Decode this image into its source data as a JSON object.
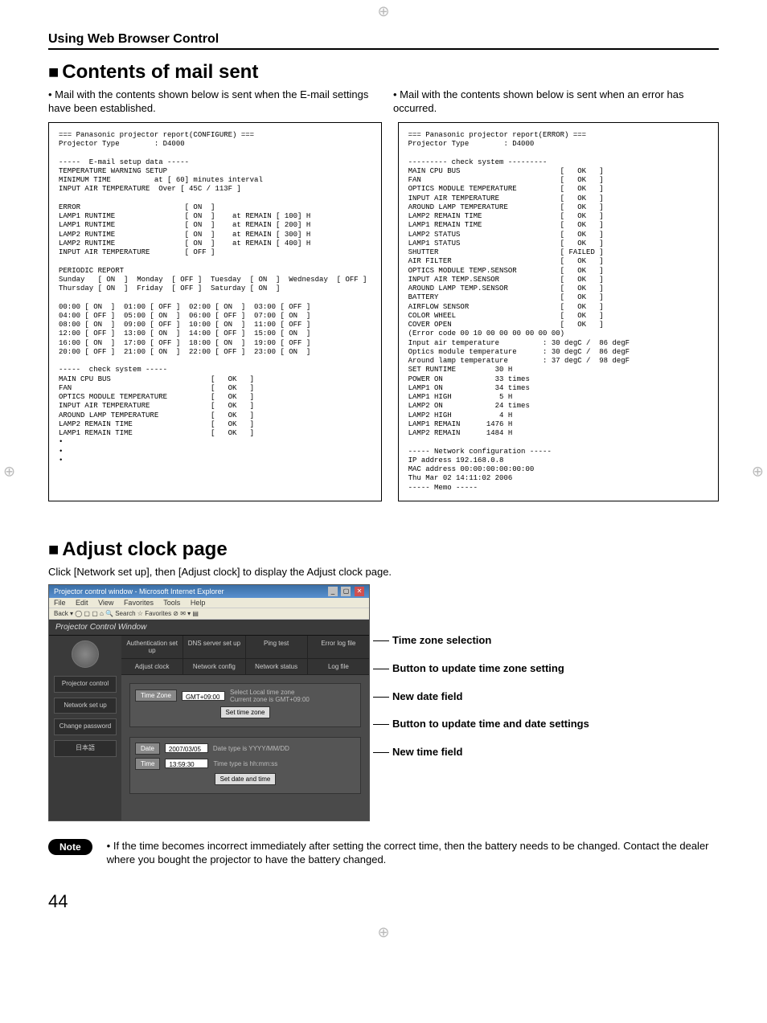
{
  "page": {
    "section_header": "Using Web Browser Control",
    "title1": "Contents of mail sent",
    "title1_marker": "■",
    "intro_left": "• Mail with the contents shown below is sent when the E-mail settings have been established.",
    "intro_right": "• Mail with the contents shown below is sent when an error has occurred.",
    "title2": "Adjust clock page",
    "title2_marker": "■",
    "clock_intro": "Click [Network set up], then [Adjust clock] to display the Adjust clock page.",
    "note_label": "Note",
    "note_text": "• If the time becomes incorrect immediately after setting the correct time, then the battery needs to be changed. Contact the dealer where you bought the projector to have the battery changed.",
    "page_number": "44"
  },
  "mail_left": "=== Panasonic projector report(CONFIGURE) ===\nProjector Type        : D4000\n\n-----  E-mail setup data -----\nTEMPERATURE WARNING SETUP\nMINIMUM TIME          at [ 60] minutes interval\nINPUT AIR TEMPERATURE  Over [ 45C / 113F ]\n\nERROR                        [ ON  ]\nLAMP1 RUNTIME                [ ON  ]    at REMAIN [ 100] H\nLAMP1 RUNTIME                [ ON  ]    at REMAIN [ 200] H\nLAMP2 RUNTIME                [ ON  ]    at REMAIN [ 300] H\nLAMP2 RUNTIME                [ ON  ]    at REMAIN [ 400] H\nINPUT AIR TEMPERATURE        [ OFF ]\n\nPERIODIC REPORT\nSunday   [ ON  ]  Monday  [ OFF ]  Tuesday  [ ON  ]  Wednesday  [ OFF ]\nThursday [ ON  ]  Friday  [ OFF ]  Saturday [ ON  ]\n\n00:00 [ ON  ]  01:00 [ OFF ]  02:00 [ ON  ]  03:00 [ OFF ]\n04:00 [ OFF ]  05:00 [ ON  ]  06:00 [ OFF ]  07:00 [ ON  ]\n08:00 [ ON  ]  09:00 [ OFF ]  10:00 [ ON  ]  11:00 [ OFF ]\n12:00 [ OFF ]  13:00 [ ON  ]  14:00 [ OFF ]  15:00 [ ON  ]\n16:00 [ ON  ]  17:00 [ OFF ]  18:00 [ ON  ]  19:00 [ OFF ]\n20:00 [ OFF ]  21:00 [ ON  ]  22:00 [ OFF ]  23:00 [ ON  ]\n\n-----  check system -----\nMAIN CPU BUS                       [   OK   ]\nFAN                                [   OK   ]\nOPTICS MODULE TEMPERATURE          [   OK   ]\nINPUT AIR TEMPERATURE              [   OK   ]\nAROUND LAMP TEMPERATURE            [   OK   ]\nLAMP2 REMAIN TIME                  [   OK   ]\nLAMP1 REMAIN TIME                  [   OK   ]\n•\n•\n•",
  "mail_right": "=== Panasonic projector report(ERROR) ===\nProjector Type        : D4000\n\n--------- check system ---------\nMAIN CPU BUS                       [   OK   ]\nFAN                                [   OK   ]\nOPTICS MODULE TEMPERATURE          [   OK   ]\nINPUT AIR TEMPERATURE              [   OK   ]\nAROUND LAMP TEMPERATURE            [   OK   ]\nLAMP2 REMAIN TIME                  [   OK   ]\nLAMP1 REMAIN TIME                  [   OK   ]\nLAMP2 STATUS                       [   OK   ]\nLAMP1 STATUS                       [   OK   ]\nSHUTTER                            [ FAILED ]\nAIR FILTER                         [   OK   ]\nOPTICS MODULE TEMP.SENSOR          [   OK   ]\nINPUT AIR TEMP.SENSOR              [   OK   ]\nAROUND LAMP TEMP.SENSOR            [   OK   ]\nBATTERY                            [   OK   ]\nAIRFLOW SENSOR                     [   OK   ]\nCOLOR WHEEL                        [   OK   ]\nCOVER OPEN                         [   OK   ]\n(Error code 00 10 00 00 00 00 00 00)\nInput air temperature          : 30 degC /  86 degF\nOptics module temperature      : 30 degC /  86 degF\nAround lamp temperature        : 37 degC /  98 degF\nSET RUNTIME         30 H\nPOWER ON            33 times\nLAMP1 ON            34 times\nLAMP1 HIGH           5 H\nLAMP2 ON            24 times\nLAMP2 HIGH           4 H\nLAMP1 REMAIN      1476 H\nLAMP2 REMAIN      1484 H\n\n----- Network configuration -----\nIP address 192.168.0.8\nMAC address 00:00:00:00:00:00\nThu Mar 02 14:11:02 2006\n----- Memo -----",
  "browser": {
    "title": "Projector control window - Microsoft Internet Explorer",
    "menu": {
      "file": "File",
      "edit": "Edit",
      "view": "View",
      "favorites": "Favorites",
      "tools": "Tools",
      "help": "Help"
    },
    "toolbar": "Back ▾   ◯   ▢ ▢ ⌂  🔍 Search  ☆ Favorites  ⊘  ✉ ▾ ▤",
    "header": "Projector Control Window",
    "sidebar": {
      "projector_control": "Projector control",
      "network_setup": "Network set up",
      "change_password": "Change password",
      "japanese": "日本語"
    },
    "tabs_row1": {
      "auth": "Authentication set up",
      "dns": "DNS server set up",
      "ping": "Ping test",
      "errlog": "Error log file"
    },
    "tabs_row2": {
      "adjust_clock": "Adjust clock",
      "netcfg": "Network config",
      "netstatus": "Network status",
      "logfile": "Log file"
    },
    "tz_label": "Time Zone",
    "tz_value": "GMT+09:00",
    "tz_hint1": "Select Local time zone",
    "tz_hint2": "Current zone is GMT+09:00",
    "tz_button": "Set time zone",
    "date_label": "Date",
    "date_value": "2007/03/05",
    "date_hint": "Date type is YYYY/MM/DD",
    "time_label": "Time",
    "time_value": "13:59:30",
    "time_hint": "Time type is hh:mm:ss",
    "dt_button": "Set date and time"
  },
  "annotations": {
    "a1": "Time zone selection",
    "a2": "Button to update time zone setting",
    "a3": "New date field",
    "a4": "Button to update time and date settings",
    "a5": "New time field"
  }
}
